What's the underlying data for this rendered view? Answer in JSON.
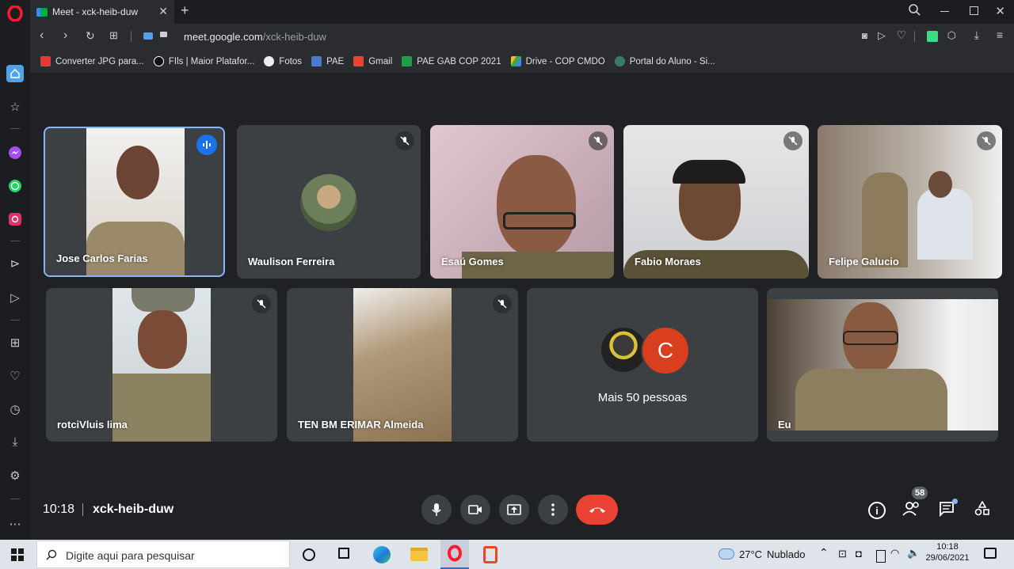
{
  "browser": {
    "tab_title": "Meet - xck-heib-duw",
    "url_domain": "meet.google.com",
    "url_path": "/xck-heib-duw"
  },
  "bookmarks": [
    {
      "label": "Converter JPG para...",
      "color": "#e53935"
    },
    {
      "label": "FIls | Maior Platafor...",
      "color": "#111111"
    },
    {
      "label": "Fotos",
      "color": "#eeeeee"
    },
    {
      "label": "PAE",
      "color": "#4a7bd0"
    },
    {
      "label": "Gmail",
      "color": "#ea4335"
    },
    {
      "label": "PAE GAB COP 2021",
      "color": "#1e9e4a"
    },
    {
      "label": "Drive - COP CMDO",
      "color": "#fbbc04"
    },
    {
      "label": "Portal do Aluno - Si...",
      "color": "#3a7a6a"
    }
  ],
  "participants": [
    {
      "name": "Jose Carlos Farias",
      "state": "speaking"
    },
    {
      "name": "Waulison Ferreira",
      "state": "muted"
    },
    {
      "name": "Esaú Gomes",
      "state": "muted"
    },
    {
      "name": "Fabio Moraes",
      "state": "muted"
    },
    {
      "name": "Felipe Galucio",
      "state": "muted"
    },
    {
      "name": "rotciVluis lima",
      "state": "muted"
    },
    {
      "name": "TEN BM ERIMAR Almeida",
      "state": "muted"
    },
    {
      "name": "Eu",
      "state": "self"
    }
  ],
  "more_people": {
    "label": "Mais 50 pessoas",
    "avatar_letter": "C"
  },
  "meeting": {
    "time": "10:18",
    "code": "xck-heib-duw",
    "participant_count": "58"
  },
  "taskbar": {
    "search_placeholder": "Digite aqui para pesquisar",
    "weather_temp": "27°C",
    "weather_desc": "Nublado",
    "clock_time": "10:18",
    "clock_date": "29/06/2021"
  },
  "colors": {
    "accent": "#1a73e8",
    "end_call": "#ea4335",
    "tile": "#3c4043",
    "background": "#202124"
  }
}
